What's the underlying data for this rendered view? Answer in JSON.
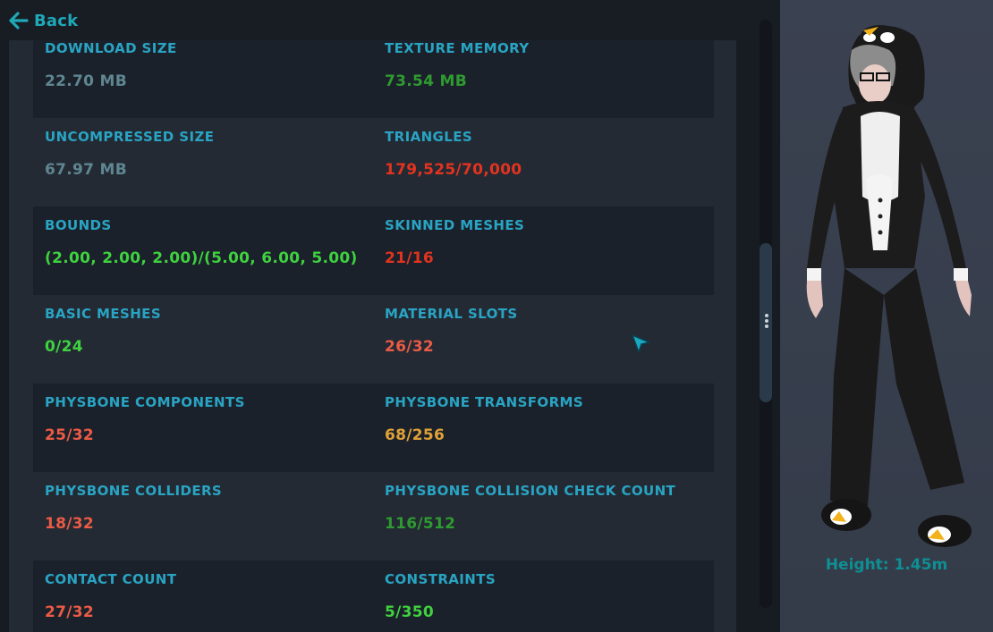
{
  "nav": {
    "back_label": "Back",
    "back_icon": "arrow-left-icon"
  },
  "stats": [
    {
      "left": {
        "label": "DOWNLOAD SIZE",
        "value": "22.70 MB",
        "color": "#5f8691"
      },
      "right": {
        "label": "TEXTURE MEMORY",
        "value": "73.54 MB",
        "color": "#2f9a31"
      }
    },
    {
      "left": {
        "label": "UNCOMPRESSED SIZE",
        "value": "67.97 MB",
        "color": "#5f8691"
      },
      "right": {
        "label": "TRIANGLES",
        "value": "179,525/70,000",
        "color": "#e2331f"
      }
    },
    {
      "left": {
        "label": "BOUNDS",
        "value": "(2.00, 2.00, 2.00)/(5.00, 6.00, 5.00)",
        "color": "#3fd13f"
      },
      "right": {
        "label": "SKINNED MESHES",
        "value": "21/16",
        "color": "#e2331f"
      }
    },
    {
      "left": {
        "label": "BASIC MESHES",
        "value": "0/24",
        "color": "#3fd13f"
      },
      "right": {
        "label": "MATERIAL SLOTS",
        "value": "26/32",
        "color": "#eb5b45"
      }
    },
    {
      "left": {
        "label": "PHYSBONE COMPONENTS",
        "value": "25/32",
        "color": "#eb5b45"
      },
      "right": {
        "label": "PHYSBONE TRANSFORMS",
        "value": "68/256",
        "color": "#e0a238"
      }
    },
    {
      "left": {
        "label": "PHYSBONE COLLIDERS",
        "value": "18/32",
        "color": "#eb5b45"
      },
      "right": {
        "label": "PHYSBONE COLLISION CHECK COUNT",
        "value": "116/512",
        "color": "#2f9a31"
      }
    },
    {
      "left": {
        "label": "CONTACT COUNT",
        "value": "27/32",
        "color": "#eb5b45"
      },
      "right": {
        "label": "CONSTRAINTS",
        "value": "5/350",
        "color": "#3fd13f"
      }
    }
  ],
  "preview": {
    "height_label": "Height: 1.45m"
  },
  "colors": {
    "accent": "#1fa8b8",
    "label": "#29a4c3"
  }
}
